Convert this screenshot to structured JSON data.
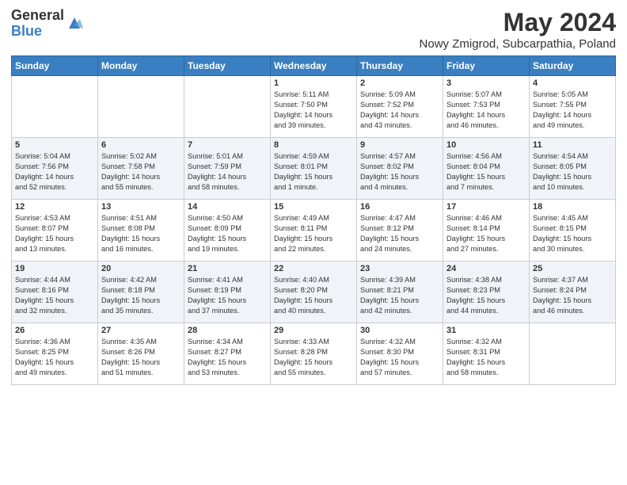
{
  "logo": {
    "general": "General",
    "blue": "Blue"
  },
  "title": "May 2024",
  "location": "Nowy Zmigrod, Subcarpathia, Poland",
  "headers": [
    "Sunday",
    "Monday",
    "Tuesday",
    "Wednesday",
    "Thursday",
    "Friday",
    "Saturday"
  ],
  "weeks": [
    [
      {
        "day": "",
        "info": ""
      },
      {
        "day": "",
        "info": ""
      },
      {
        "day": "",
        "info": ""
      },
      {
        "day": "1",
        "info": "Sunrise: 5:11 AM\nSunset: 7:50 PM\nDaylight: 14 hours\nand 39 minutes."
      },
      {
        "day": "2",
        "info": "Sunrise: 5:09 AM\nSunset: 7:52 PM\nDaylight: 14 hours\nand 43 minutes."
      },
      {
        "day": "3",
        "info": "Sunrise: 5:07 AM\nSunset: 7:53 PM\nDaylight: 14 hours\nand 46 minutes."
      },
      {
        "day": "4",
        "info": "Sunrise: 5:05 AM\nSunset: 7:55 PM\nDaylight: 14 hours\nand 49 minutes."
      }
    ],
    [
      {
        "day": "5",
        "info": "Sunrise: 5:04 AM\nSunset: 7:56 PM\nDaylight: 14 hours\nand 52 minutes."
      },
      {
        "day": "6",
        "info": "Sunrise: 5:02 AM\nSunset: 7:58 PM\nDaylight: 14 hours\nand 55 minutes."
      },
      {
        "day": "7",
        "info": "Sunrise: 5:01 AM\nSunset: 7:59 PM\nDaylight: 14 hours\nand 58 minutes."
      },
      {
        "day": "8",
        "info": "Sunrise: 4:59 AM\nSunset: 8:01 PM\nDaylight: 15 hours\nand 1 minute."
      },
      {
        "day": "9",
        "info": "Sunrise: 4:57 AM\nSunset: 8:02 PM\nDaylight: 15 hours\nand 4 minutes."
      },
      {
        "day": "10",
        "info": "Sunrise: 4:56 AM\nSunset: 8:04 PM\nDaylight: 15 hours\nand 7 minutes."
      },
      {
        "day": "11",
        "info": "Sunrise: 4:54 AM\nSunset: 8:05 PM\nDaylight: 15 hours\nand 10 minutes."
      }
    ],
    [
      {
        "day": "12",
        "info": "Sunrise: 4:53 AM\nSunset: 8:07 PM\nDaylight: 15 hours\nand 13 minutes."
      },
      {
        "day": "13",
        "info": "Sunrise: 4:51 AM\nSunset: 8:08 PM\nDaylight: 15 hours\nand 16 minutes."
      },
      {
        "day": "14",
        "info": "Sunrise: 4:50 AM\nSunset: 8:09 PM\nDaylight: 15 hours\nand 19 minutes."
      },
      {
        "day": "15",
        "info": "Sunrise: 4:49 AM\nSunset: 8:11 PM\nDaylight: 15 hours\nand 22 minutes."
      },
      {
        "day": "16",
        "info": "Sunrise: 4:47 AM\nSunset: 8:12 PM\nDaylight: 15 hours\nand 24 minutes."
      },
      {
        "day": "17",
        "info": "Sunrise: 4:46 AM\nSunset: 8:14 PM\nDaylight: 15 hours\nand 27 minutes."
      },
      {
        "day": "18",
        "info": "Sunrise: 4:45 AM\nSunset: 8:15 PM\nDaylight: 15 hours\nand 30 minutes."
      }
    ],
    [
      {
        "day": "19",
        "info": "Sunrise: 4:44 AM\nSunset: 8:16 PM\nDaylight: 15 hours\nand 32 minutes."
      },
      {
        "day": "20",
        "info": "Sunrise: 4:42 AM\nSunset: 8:18 PM\nDaylight: 15 hours\nand 35 minutes."
      },
      {
        "day": "21",
        "info": "Sunrise: 4:41 AM\nSunset: 8:19 PM\nDaylight: 15 hours\nand 37 minutes."
      },
      {
        "day": "22",
        "info": "Sunrise: 4:40 AM\nSunset: 8:20 PM\nDaylight: 15 hours\nand 40 minutes."
      },
      {
        "day": "23",
        "info": "Sunrise: 4:39 AM\nSunset: 8:21 PM\nDaylight: 15 hours\nand 42 minutes."
      },
      {
        "day": "24",
        "info": "Sunrise: 4:38 AM\nSunset: 8:23 PM\nDaylight: 15 hours\nand 44 minutes."
      },
      {
        "day": "25",
        "info": "Sunrise: 4:37 AM\nSunset: 8:24 PM\nDaylight: 15 hours\nand 46 minutes."
      }
    ],
    [
      {
        "day": "26",
        "info": "Sunrise: 4:36 AM\nSunset: 8:25 PM\nDaylight: 15 hours\nand 49 minutes."
      },
      {
        "day": "27",
        "info": "Sunrise: 4:35 AM\nSunset: 8:26 PM\nDaylight: 15 hours\nand 51 minutes."
      },
      {
        "day": "28",
        "info": "Sunrise: 4:34 AM\nSunset: 8:27 PM\nDaylight: 15 hours\nand 53 minutes."
      },
      {
        "day": "29",
        "info": "Sunrise: 4:33 AM\nSunset: 8:28 PM\nDaylight: 15 hours\nand 55 minutes."
      },
      {
        "day": "30",
        "info": "Sunrise: 4:32 AM\nSunset: 8:30 PM\nDaylight: 15 hours\nand 57 minutes."
      },
      {
        "day": "31",
        "info": "Sunrise: 4:32 AM\nSunset: 8:31 PM\nDaylight: 15 hours\nand 58 minutes."
      },
      {
        "day": "",
        "info": ""
      }
    ]
  ]
}
